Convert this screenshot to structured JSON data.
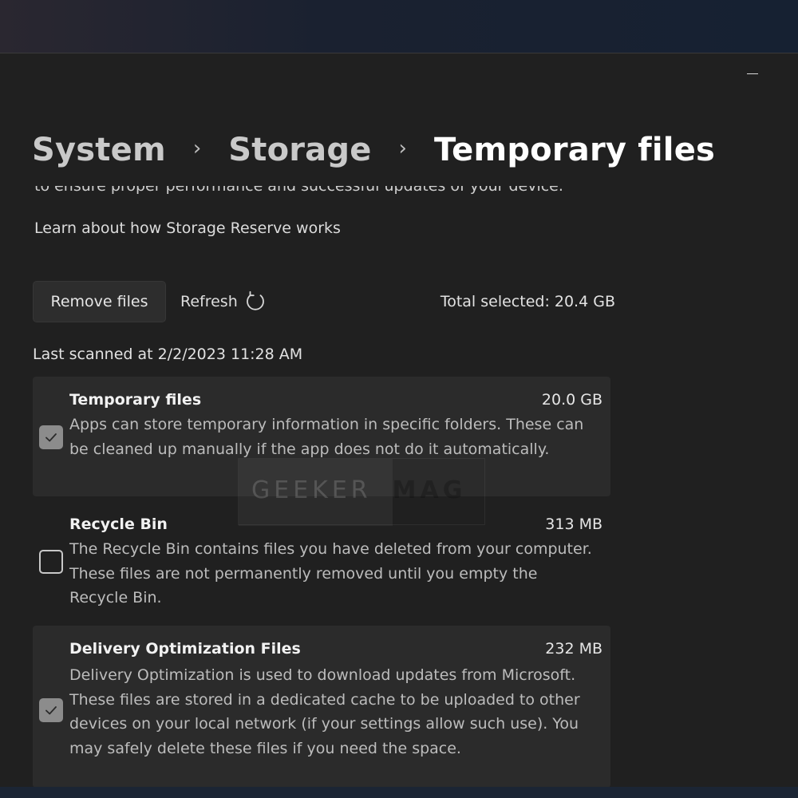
{
  "window": {
    "minimize_label": "Minimize"
  },
  "breadcrumb": {
    "items": [
      "System",
      "Storage",
      "Temporary files"
    ],
    "separator": "›"
  },
  "intro": {
    "partial_text": "to ensure proper performance and successful updates of your device.",
    "learn_link": "Learn about how Storage Reserve works"
  },
  "toolbar": {
    "remove_label": "Remove files",
    "refresh_label": "Refresh",
    "total_selected": "Total selected: 20.4 GB"
  },
  "scan": {
    "last_scanned": "Last scanned at 2/2/2023 11:28 AM"
  },
  "items": [
    {
      "title": "Temporary files",
      "size": "20.0 GB",
      "checked": true,
      "description": "Apps can store temporary information in specific folders. These can be cleaned up manually if the app does not do it automatically."
    },
    {
      "title": "Recycle Bin",
      "size": "313 MB",
      "checked": false,
      "description": "The Recycle Bin contains files you have deleted from your computer. These files are not permanently removed until you empty the Recycle Bin."
    },
    {
      "title": "Delivery Optimization Files",
      "size": "232 MB",
      "checked": true,
      "description": "Delivery Optimization is used to download updates from Microsoft. These files are stored in a dedicated cache to be uploaded to other devices on your local network (if your settings allow such use). You may safely delete these files if you need the space."
    }
  ],
  "watermark": {
    "part1": "GEEKER",
    "part2": "MAG"
  },
  "icons": {
    "refresh": "refresh-icon",
    "check": "check-icon",
    "minimize": "minimize-icon"
  },
  "colors": {
    "window_bg": "#202020",
    "highlight_row": "#2b2b2b",
    "checkbox_checked": "#8c8c8c"
  }
}
